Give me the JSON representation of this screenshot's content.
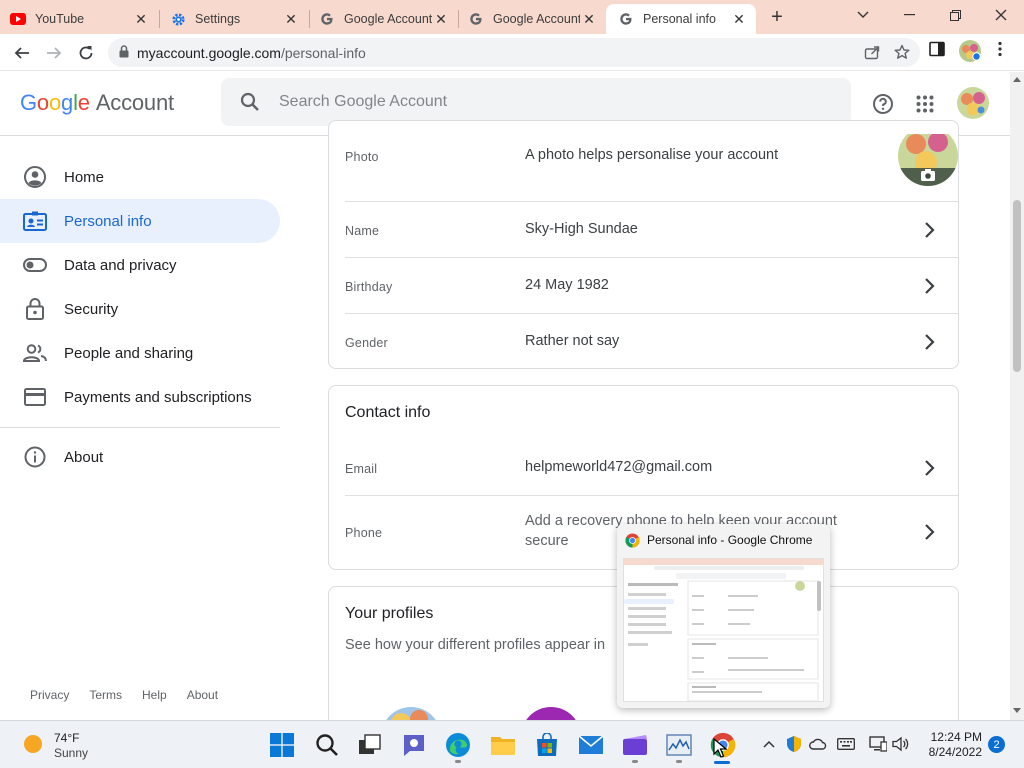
{
  "browser": {
    "tabs": [
      {
        "title": "YouTube",
        "icon": "youtube-icon"
      },
      {
        "title": "Settings",
        "icon": "gear-icon"
      },
      {
        "title": "Google Account",
        "icon": "google-icon"
      },
      {
        "title": "Google Account",
        "icon": "google-icon"
      },
      {
        "title": "Personal info",
        "icon": "google-icon",
        "active": true
      }
    ],
    "url_host": "myaccount.google.com",
    "url_path": "/personal-info"
  },
  "header": {
    "logo_word": "Google",
    "logo_suffix": "Account",
    "search_placeholder": "Search Google Account"
  },
  "sidebar": {
    "items": [
      {
        "label": "Home",
        "icon": "home-icon"
      },
      {
        "label": "Personal info",
        "icon": "personal-info-icon",
        "active": true
      },
      {
        "label": "Data and privacy",
        "icon": "toggle-icon"
      },
      {
        "label": "Security",
        "icon": "lock-icon"
      },
      {
        "label": "People and sharing",
        "icon": "people-icon"
      },
      {
        "label": "Payments and subscriptions",
        "icon": "card-icon"
      }
    ],
    "about": "About",
    "footer": [
      "Privacy",
      "Terms",
      "Help",
      "About"
    ]
  },
  "basic_info": {
    "photo_label": "Photo",
    "photo_text": "A photo helps personalise your account",
    "rows": [
      {
        "label": "Name",
        "value": "Sky-High Sundae"
      },
      {
        "label": "Birthday",
        "value": "24 May 1982"
      },
      {
        "label": "Gender",
        "value": "Rather not say"
      }
    ]
  },
  "contact_info": {
    "title": "Contact info",
    "email_label": "Email",
    "email_value": "helpmeworld472@gmail.com",
    "phone_label": "Phone",
    "phone_value_line1": "Add a recovery phone to help keep your account",
    "phone_value_line2": "secure"
  },
  "profiles": {
    "title": "Your profiles",
    "subtitle": "See how your different profiles appear in"
  },
  "preview": {
    "title": "Personal info - Google Chrome"
  },
  "taskbar": {
    "temp": "74°F",
    "condition": "Sunny",
    "time": "12:24 PM",
    "date": "8/24/2022",
    "notifications": "2"
  },
  "colors": {
    "accent": "#1a73e8",
    "active_nav_bg": "#e8f0fe",
    "tabstrip_bg": "#f7d9cd"
  }
}
